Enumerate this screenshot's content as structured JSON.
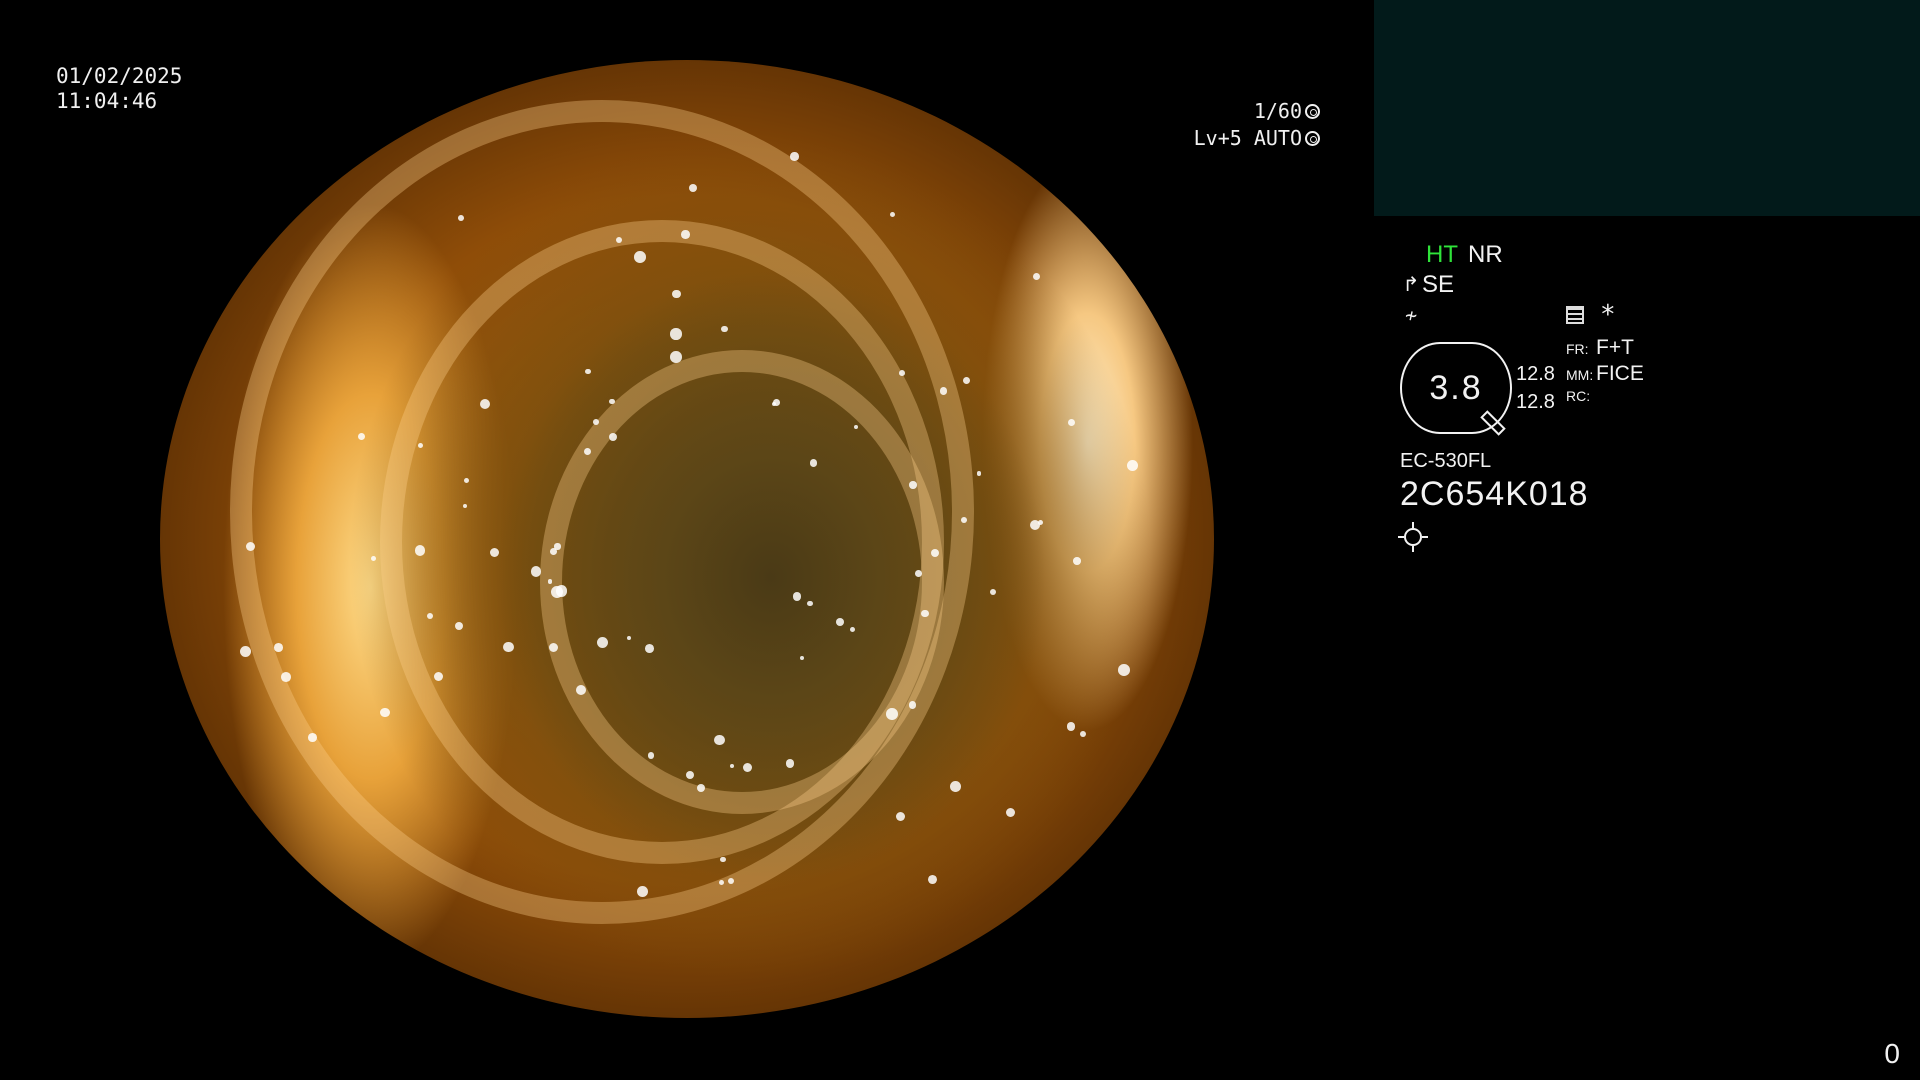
{
  "datetime": {
    "date": "01/02/2025",
    "time": "11:04:46"
  },
  "exposure": {
    "shutter": "1/60",
    "level": "Lv+5 AUTO",
    "shutter_icon": "aperture-icon",
    "auto_icon": "auto-exposure-icon"
  },
  "image_modes": {
    "ht": "HT",
    "nr": "NR",
    "se": "SE",
    "se_icon": "enhance-icon",
    "flat_icon": "flat-icon"
  },
  "scope": {
    "magnification": "3.8",
    "zoom_values": [
      "12.8",
      "12.8"
    ],
    "params": [
      {
        "key": "FR:",
        "value": "F+T"
      },
      {
        "key": "MM:",
        "value": "FICE"
      },
      {
        "key": "RC:",
        "value": ""
      }
    ],
    "model": "EC-530FL",
    "serial": "2C654K018"
  },
  "colors": {
    "ht_accent": "#2fe33a",
    "sub_screen_bg": "#021a1a"
  },
  "counter": "0"
}
